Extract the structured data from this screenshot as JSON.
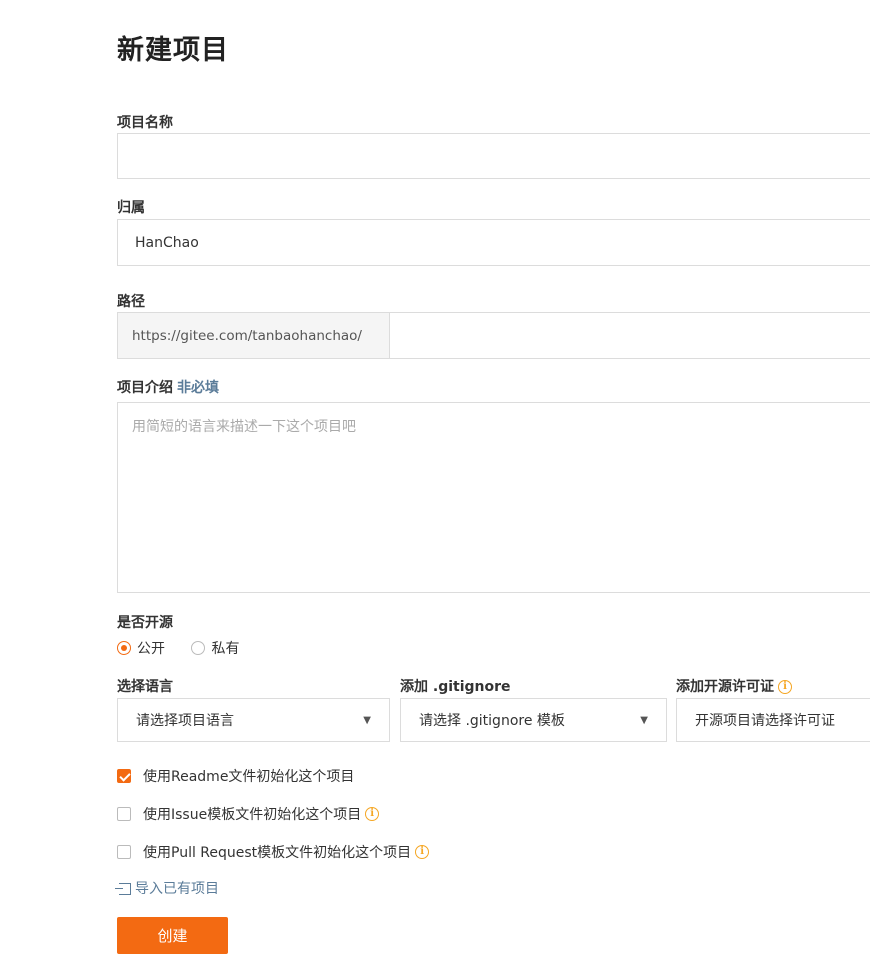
{
  "page_title": "新建项目",
  "project_name": {
    "label": "项目名称",
    "value": ""
  },
  "owner": {
    "label": "归属",
    "value": "HanChao"
  },
  "path": {
    "label": "路径",
    "prefix": "https://gitee.com/tanbaohanchao/",
    "value": ""
  },
  "description": {
    "label": "项目介绍",
    "optional_tag": "非必填",
    "placeholder": "用简短的语言来描述一下这个项目吧"
  },
  "visibility": {
    "label": "是否开源",
    "options": [
      {
        "label": "公开",
        "selected": true
      },
      {
        "label": "私有",
        "selected": false
      }
    ]
  },
  "language": {
    "label": "选择语言",
    "value": "请选择项目语言"
  },
  "gitignore": {
    "label": "添加 .gitignore",
    "value": "请选择 .gitignore 模板"
  },
  "license": {
    "label": "添加开源许可证",
    "value": "开源项目请选择许可证"
  },
  "init_options": [
    {
      "label": "使用Readme文件初始化这个项目",
      "checked": true,
      "info": false
    },
    {
      "label": "使用Issue模板文件初始化这个项目",
      "checked": false,
      "info": true
    },
    {
      "label": "使用Pull Request模板文件初始化这个项目",
      "checked": false,
      "info": true
    }
  ],
  "import_link": "导入已有项目",
  "create_button": "创建",
  "colors": {
    "accent": "#f36a12",
    "info": "#f5a623",
    "link": "#5b7c99"
  },
  "icons": {
    "info": "info-icon",
    "import": "import-icon",
    "caret": "chevron-down-icon"
  }
}
